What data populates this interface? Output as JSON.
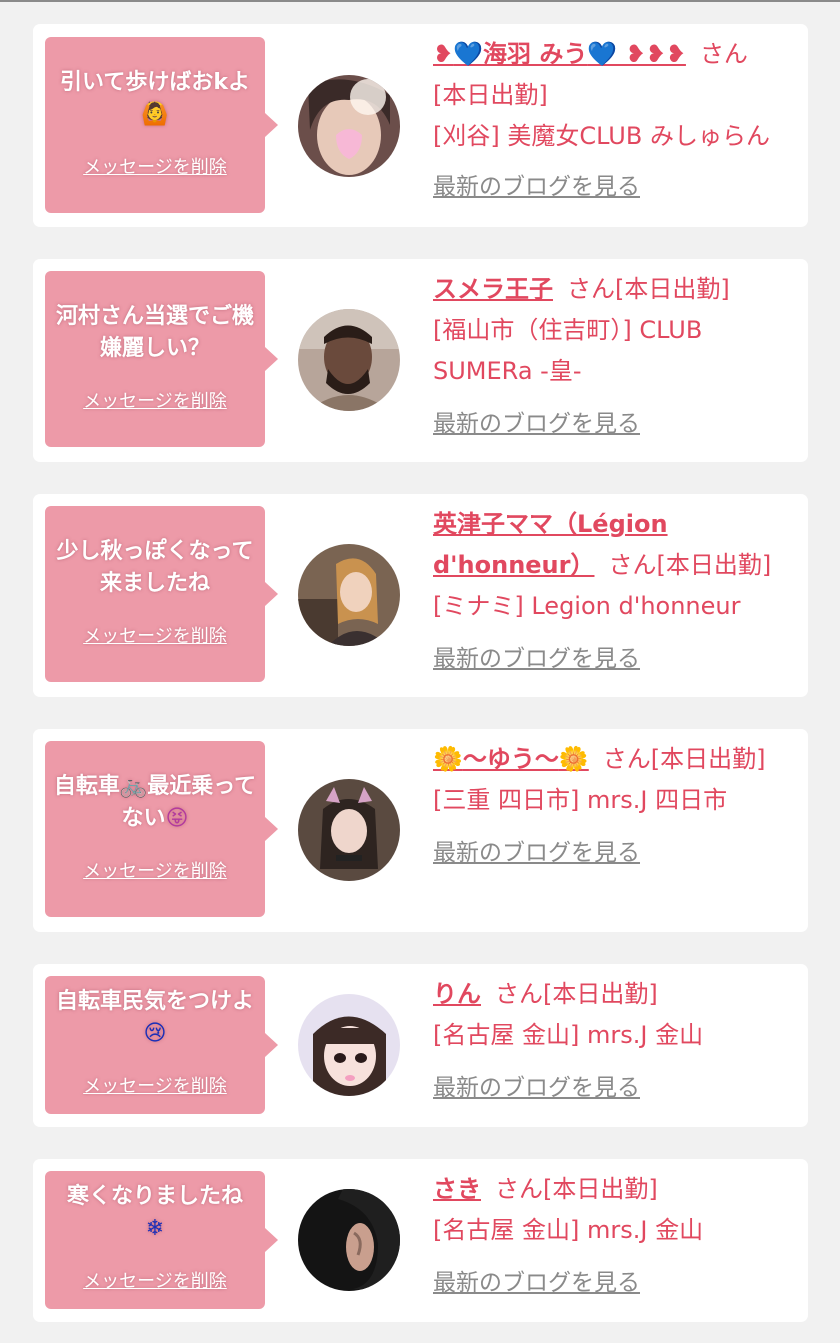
{
  "delete_label": "メッセージを削除",
  "san_label": "さん",
  "work_label": "[本日出勤]",
  "blog_label": "最新のブログを見る",
  "colors": {
    "bubble": "#ed9aa8",
    "accent": "#e1485f",
    "link_gray": "#8a8a8a",
    "background": "#f1f1f1"
  },
  "cards": [
    {
      "message": "引いて歩けばおkよ",
      "message_emoji": "🙆",
      "name_prefix": "❥",
      "name_heart": "💙",
      "name_text": "海羽 みう",
      "name_suffix": "💙 ❥❥❥",
      "shop": "[刈谷] 美魔女CLUB みしゅらん",
      "avatar_icon": "avatar-photo-icon"
    },
    {
      "message": "河村さん当選でご機嫌麗しい？",
      "name_text": "スメラ王子",
      "shop": "[福山市（住吉町）] CLUB SUMERa -皇-",
      "avatar_icon": "avatar-photo-icon"
    },
    {
      "message": "少し秋っぽくなって来ましたね",
      "name_text": "英津子ママ（Légion d'honneur）",
      "shop": "[ミナミ] Legion d'honneur",
      "avatar_icon": "avatar-photo-icon"
    },
    {
      "message_part1": "自転車",
      "message_bike": "🚲",
      "message_part2": "最近乗ってない",
      "message_emoji": "😝",
      "name_flower": "🌼",
      "name_text": "〜ゆう〜",
      "shop": "[三重 四日市] mrs.J 四日市",
      "avatar_icon": "avatar-photo-icon"
    },
    {
      "message": "自転車民気をつけよ",
      "message_emoji": "😢",
      "name_text": "りん",
      "shop": "[名古屋 金山] mrs.J 金山",
      "avatar_icon": "avatar-photo-icon"
    },
    {
      "message": "寒くなりましたね",
      "message_emoji": "❄",
      "name_text": "さき",
      "shop": "[名古屋 金山] mrs.J 金山",
      "avatar_icon": "avatar-photo-icon"
    }
  ]
}
